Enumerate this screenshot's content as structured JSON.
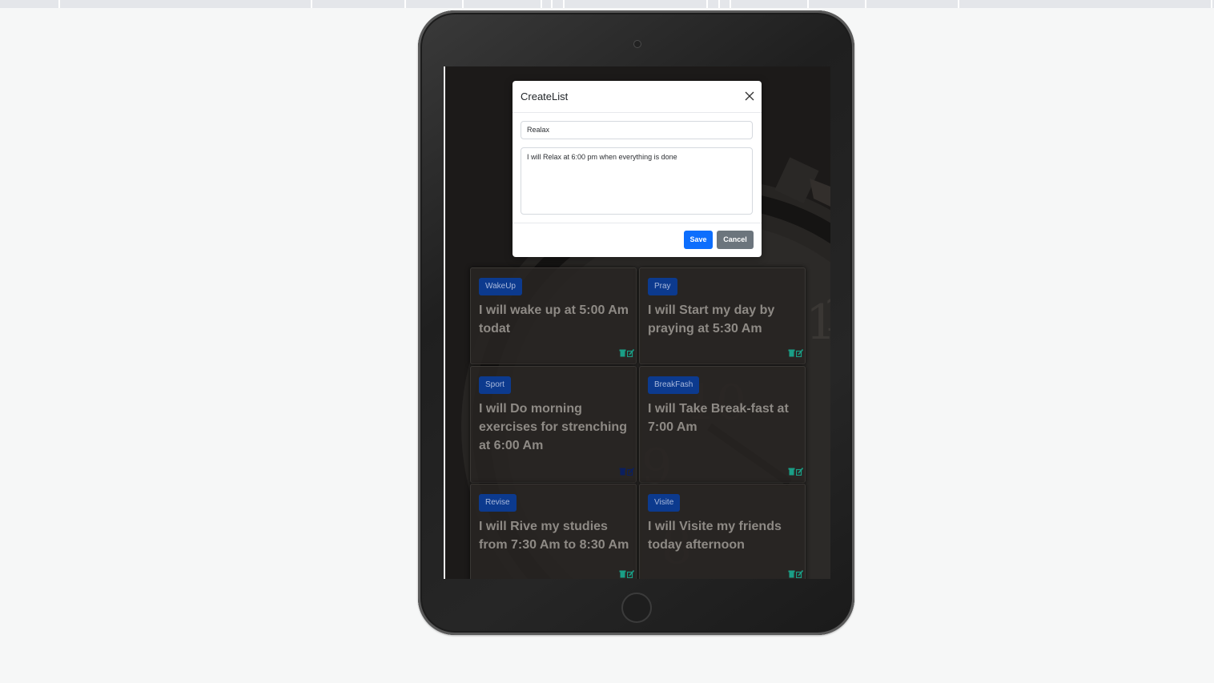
{
  "modal": {
    "title": "CreateList",
    "title_input_value": "Realax",
    "description_value": "I will Relax at 6:00 pm when everything is done",
    "save_label": "Save",
    "cancel_label": "Cancel"
  },
  "cards": [
    {
      "badge": "WakeUp",
      "text": "I will wake up at 5:00 Am todat"
    },
    {
      "badge": "Pray",
      "text": "I will Start my day by praying at 5:30 Am"
    },
    {
      "badge": "Sport",
      "text": "I will Do morning exercises for strenching at 6:00 Am"
    },
    {
      "badge": "BreakFash",
      "text": "I will Take Break-fast at 7:00 Am"
    },
    {
      "badge": "Revise",
      "text": "I will Rive my studies from 7:30 Am to 8:30 Am"
    },
    {
      "badge": "Visite",
      "text": "I will Visite my friends today afternoon"
    }
  ],
  "colors": {
    "primary": "#0d6efd",
    "secondary": "#6c757d",
    "badge": "#0c3a8e",
    "action_icon": "#1a9e86"
  },
  "icons": {
    "delete": "trash-icon",
    "edit": "edit-icon",
    "close": "close-icon"
  }
}
